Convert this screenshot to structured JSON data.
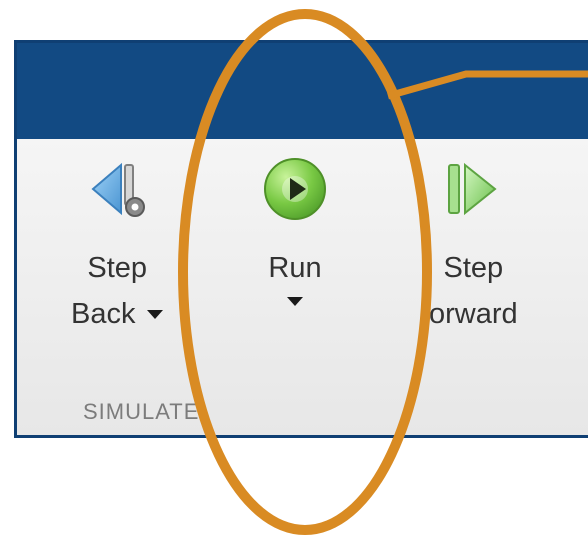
{
  "toolstrip": {
    "section_label": "SIMULATE",
    "buttons": {
      "step_back": {
        "line1": "Step",
        "line2": "Back",
        "has_dropdown": true,
        "icon": "step-back-icon"
      },
      "run": {
        "line1": "Run",
        "has_dropdown": true,
        "icon": "run-icon"
      },
      "step_forward": {
        "line1": "Step",
        "line2": "orward",
        "icon": "step-forward-icon"
      }
    }
  },
  "colors": {
    "titlebar": "#124a83",
    "toolstrip_background": "#efefef",
    "annotation_stroke": "#d98b23",
    "run_icon": "#6bbf3a",
    "step_forward_icon": "#67c24f",
    "step_back_icon": "#6aaee3"
  },
  "annotation": {
    "shape": "ellipse",
    "target": "run-button"
  }
}
